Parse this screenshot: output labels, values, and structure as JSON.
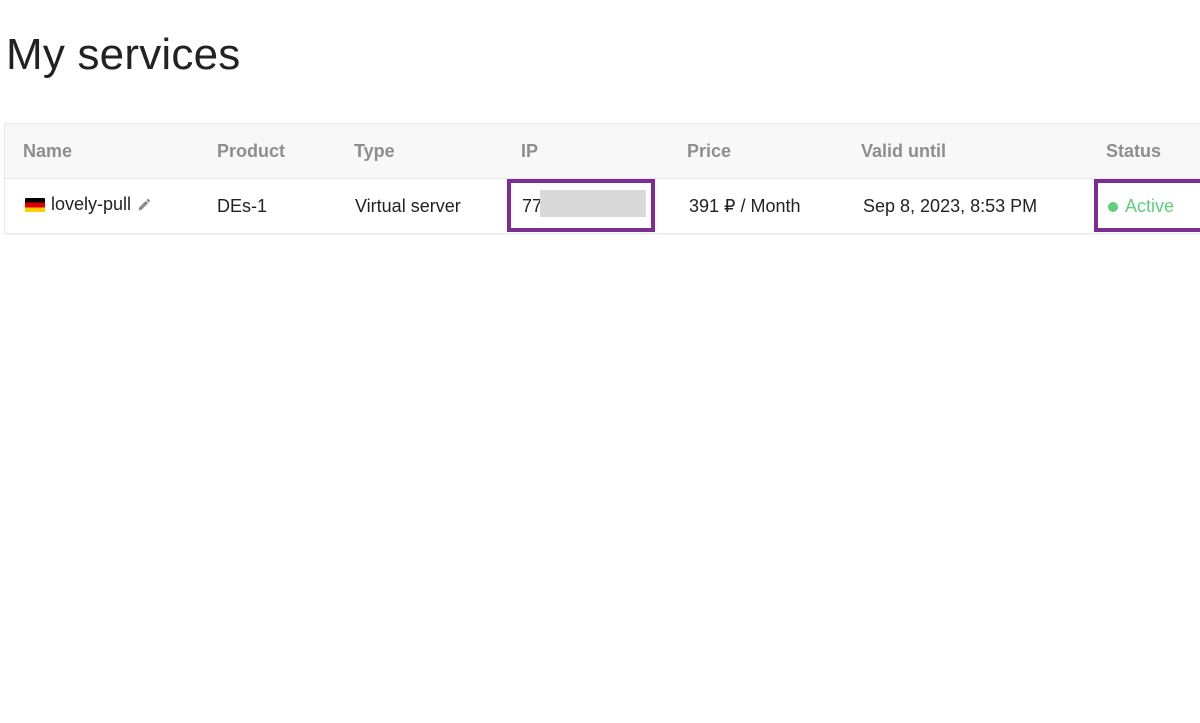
{
  "page": {
    "title": "My services"
  },
  "table": {
    "columns": {
      "name": "Name",
      "product": "Product",
      "type": "Type",
      "ip": "IP",
      "price": "Price",
      "valid_until": "Valid until",
      "status": "Status"
    },
    "rows": [
      {
        "flag": "germany-flag-icon",
        "name": "lovely-pull",
        "product": "DEs-1",
        "type": "Virtual server",
        "ip": "77",
        "price": "391 ₽ / Month",
        "valid_until": "Sep 8, 2023, 8:53 PM",
        "status": "Active"
      }
    ]
  },
  "colors": {
    "highlight": "#7f2b96",
    "status_active": "#5fcf7c",
    "header_text": "#8e8e8e"
  }
}
